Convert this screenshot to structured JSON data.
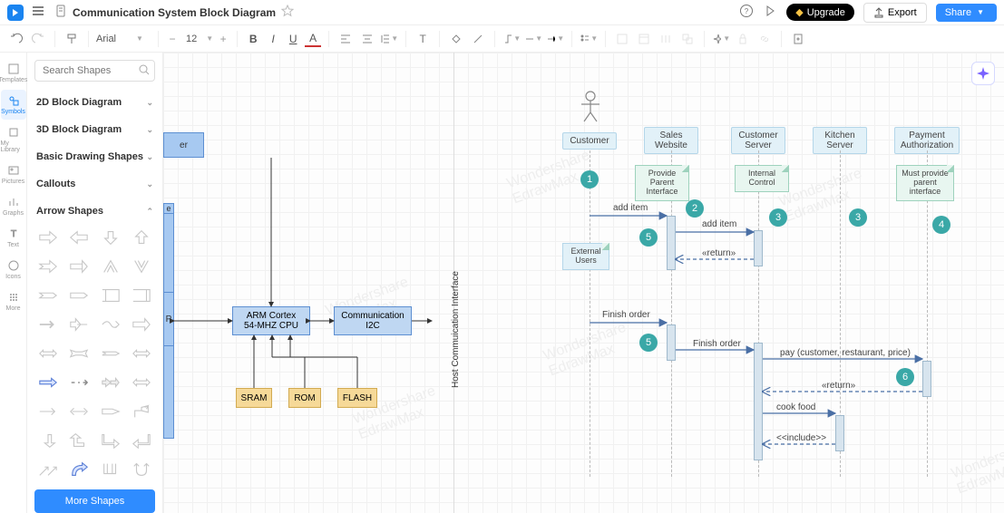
{
  "header": {
    "title": "Communication System Block Diagram",
    "help": "?",
    "upgrade_label": "Upgrade",
    "export_label": "Export",
    "share_label": "Share"
  },
  "toolbar": {
    "font": "Arial",
    "font_size": "12"
  },
  "rail": {
    "templates": "Templates",
    "symbols": "Symbols",
    "mylib": "My Library",
    "pictures": "Pictures",
    "graphs": "Graphs",
    "text": "Text",
    "icons": "Icons",
    "more": "More"
  },
  "shapes": {
    "search_placeholder": "Search Shapes",
    "cat_2d": "2D Block Diagram",
    "cat_3d": "3D Block Diagram",
    "cat_basic": "Basic Drawing Shapes",
    "cat_callouts": "Callouts",
    "cat_arrow": "Arrow Shapes",
    "more": "More Shapes"
  },
  "diagram_left": {
    "er": "er",
    "e": "e",
    "p": "P",
    "cpu1": "ARM Cortex",
    "cpu2": "54-MHZ CPU",
    "comm1": "Communication",
    "comm2": "I2C",
    "sram": "SRAM",
    "rom": "ROM",
    "flash": "FLASH",
    "host": "Host Commuication Interface"
  },
  "seq": {
    "heads": {
      "customer": "Customer",
      "sales1": "Sales",
      "sales2": "Website",
      "cs1": "Customer",
      "cs2": "Server",
      "ks1": "Kitchen",
      "ks2": "Server",
      "pa1": "Payment",
      "pa2": "Authorization"
    },
    "notes": {
      "provide": "Provide Parent Interface",
      "internal": "Internal Control",
      "must": "Must provide parent interface",
      "external": "External Users"
    },
    "badges": {
      "b1": "1",
      "b2": "2",
      "b3": "3",
      "b4": "3",
      "b5a": "5",
      "b5b": "5",
      "b6": "4",
      "b7": "6"
    },
    "msg": {
      "add1": "add item",
      "add2": "add item",
      "ret1": "«return»",
      "fin1": "Finish order",
      "fin2": "Finish order",
      "pay": "pay (customer, restaurant, price)",
      "ret2": "«return»",
      "cook": "cook food",
      "inc": "<<include>>"
    }
  }
}
